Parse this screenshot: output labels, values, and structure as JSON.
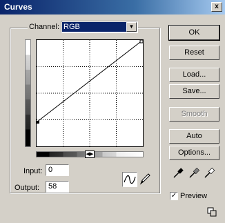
{
  "window": {
    "title": "Curves",
    "close_glyph": "x"
  },
  "channel": {
    "label": "Channel:",
    "value": "RGB"
  },
  "input": {
    "label": "Input:",
    "value": "0"
  },
  "output": {
    "label": "Output:",
    "value": "58"
  },
  "buttons": {
    "ok": "OK",
    "reset": "Reset",
    "load": "Load...",
    "save": "Save...",
    "smooth": "Smooth",
    "auto": "Auto",
    "options": "Options..."
  },
  "preview": {
    "label": "Preview",
    "checked": true
  },
  "curve": {
    "points": [
      [
        0,
        58
      ],
      [
        255,
        255
      ]
    ]
  },
  "colors": {
    "title_start": "#0a246a",
    "title_end": "#a6caf0",
    "face": "#d4d0c8",
    "selection": "#0a246a"
  }
}
